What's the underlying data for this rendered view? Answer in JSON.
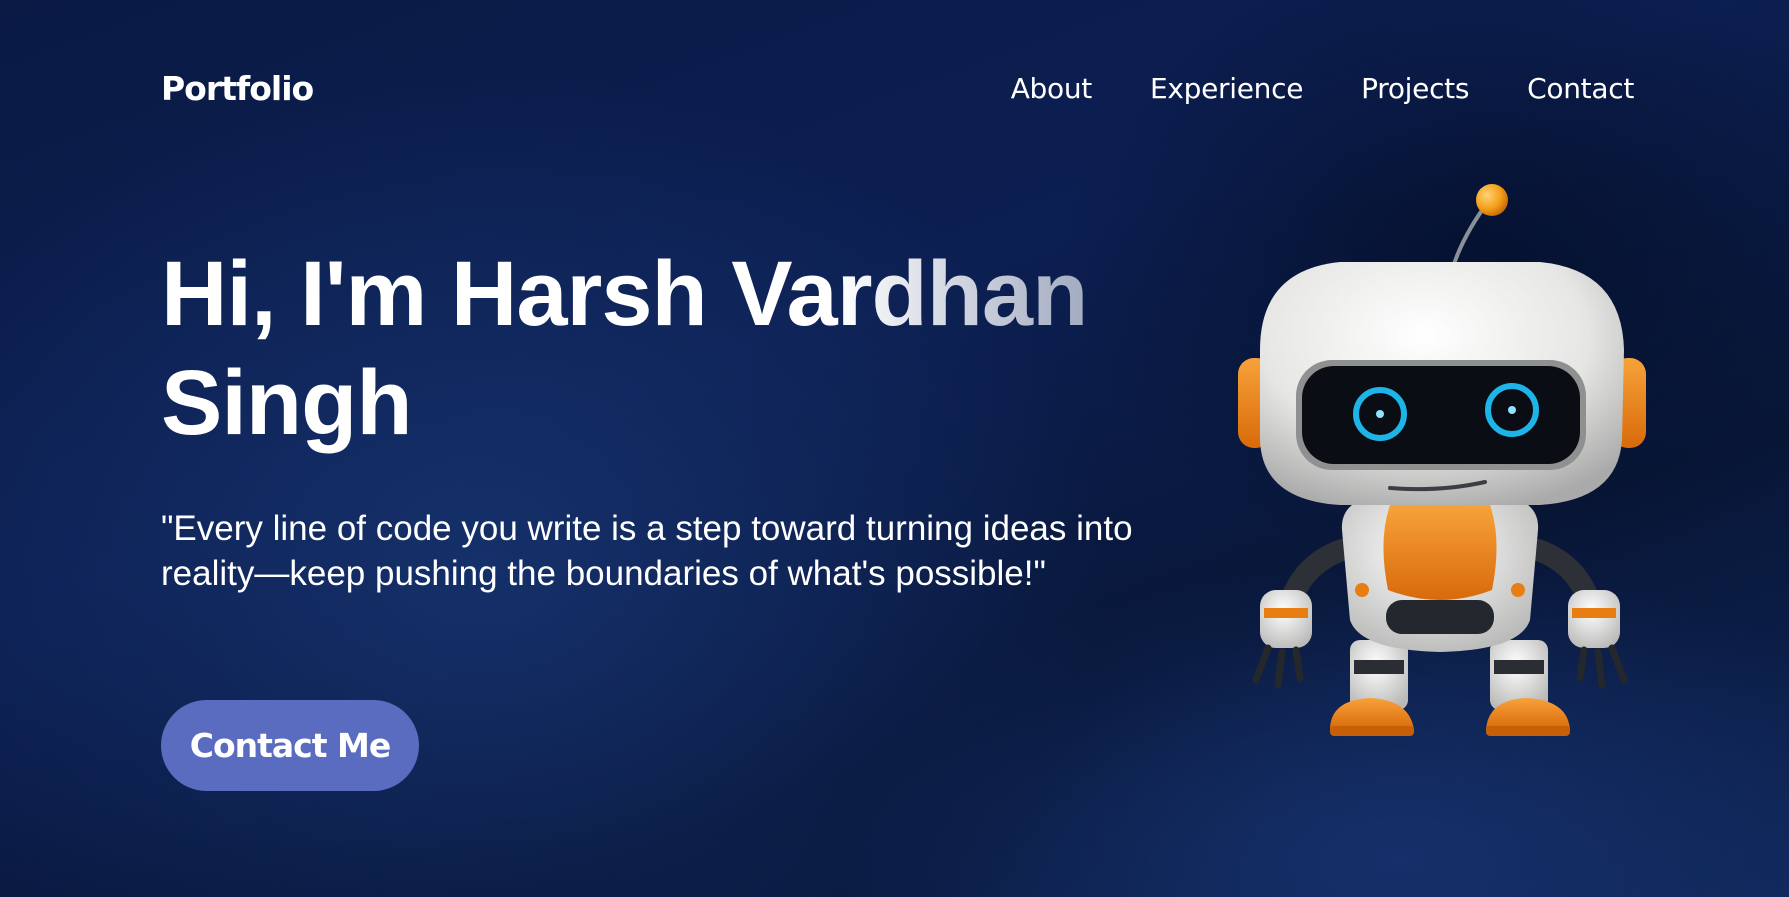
{
  "nav": {
    "logo": "Portfolio",
    "links": [
      "About",
      "Experience",
      "Projects",
      "Contact"
    ]
  },
  "hero": {
    "title_line1": "Hi, I'm Harsh Vardhan",
    "title_line2": "Singh",
    "quote": "\"Every line of code you write is a step toward turning ideas into reality—keep pushing the boundaries of what's possible!\"",
    "cta_label": "Contact Me",
    "robot_icon": "robot-icon"
  },
  "colors": {
    "background": "#0c1f52",
    "button": "#5a6cc0",
    "robot_accent": "#f08a1c",
    "robot_eye": "#1fb4e8"
  }
}
